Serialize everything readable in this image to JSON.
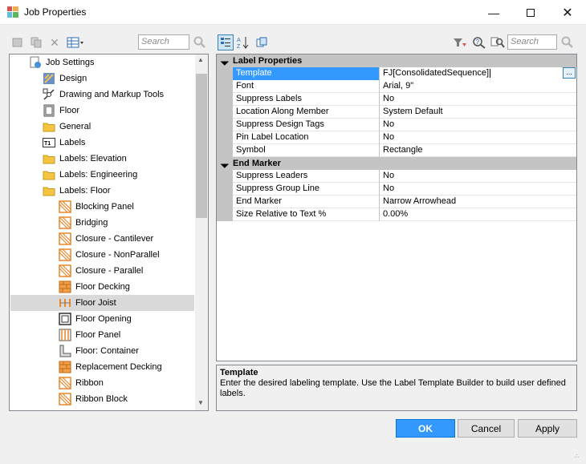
{
  "window": {
    "title": "Job Properties",
    "icon": "job-properties-icon"
  },
  "toolbar_left": {
    "icons": [
      "new-icon",
      "copy-icon",
      "delete-icon",
      "view-options-icon"
    ],
    "search_placeholder": "Search"
  },
  "toolbar_right": {
    "icons": [
      "categorized-icon",
      "sort-alpha-icon",
      "property-pages-icon"
    ],
    "filter_icons": [
      "filter-icon",
      "help-search-icon",
      "find-icon"
    ],
    "search_placeholder": "Search"
  },
  "tree": {
    "items": [
      {
        "label": "Job Settings",
        "icon": "job-settings-icon"
      },
      {
        "label": "Design",
        "icon": "design-icon"
      },
      {
        "label": "Drawing and Markup Tools",
        "icon": "markup-tools-icon"
      },
      {
        "label": "Floor",
        "icon": "floor-icon"
      },
      {
        "label": "General",
        "icon": "folder-icon"
      },
      {
        "label": "Labels",
        "icon": "labels-t1-icon"
      },
      {
        "label": "Labels: Elevation",
        "icon": "folder-icon"
      },
      {
        "label": "Labels: Engineering",
        "icon": "folder-icon"
      },
      {
        "label": "Labels: Floor",
        "icon": "folder-icon"
      },
      {
        "label": "Blocking Panel",
        "icon": "blocking-panel-icon"
      },
      {
        "label": "Bridging",
        "icon": "bridging-icon"
      },
      {
        "label": "Closure - Cantilever",
        "icon": "closure-icon"
      },
      {
        "label": "Closure - NonParallel",
        "icon": "closure-icon"
      },
      {
        "label": "Closure - Parallel",
        "icon": "closure-icon"
      },
      {
        "label": "Floor Decking",
        "icon": "decking-icon"
      },
      {
        "label": "Floor Joist",
        "icon": "joist-icon",
        "selected": true
      },
      {
        "label": "Floor Opening",
        "icon": "opening-icon"
      },
      {
        "label": "Floor Panel",
        "icon": "panel-icon"
      },
      {
        "label": "Floor: Container",
        "icon": "container-icon"
      },
      {
        "label": "Replacement Decking",
        "icon": "decking-icon"
      },
      {
        "label": "Ribbon",
        "icon": "ribbon-icon"
      },
      {
        "label": "Ribbon Block",
        "icon": "ribbon-block-icon"
      }
    ]
  },
  "grid": {
    "categories": [
      {
        "name": "Label Properties",
        "rows": [
          {
            "name": "Template",
            "value": "FJ[ConsolidatedSequence]",
            "selected": true
          },
          {
            "name": "Font",
            "value": "Arial, 9\""
          },
          {
            "name": "Suppress Labels",
            "value": "No"
          },
          {
            "name": "Location Along Member",
            "value": "System Default"
          },
          {
            "name": "Suppress Design Tags",
            "value": "No"
          },
          {
            "name": "Pin Label Location",
            "value": "No"
          },
          {
            "name": "Symbol",
            "value": "Rectangle"
          }
        ]
      },
      {
        "name": "End Marker",
        "rows": [
          {
            "name": "Suppress Leaders",
            "value": "No"
          },
          {
            "name": "Suppress Group Line",
            "value": "No"
          },
          {
            "name": "End Marker",
            "value": "Narrow Arrowhead"
          },
          {
            "name": "Size Relative to Text %",
            "value": "0.00%"
          }
        ]
      }
    ],
    "ellipsis_label": "..."
  },
  "help": {
    "title": "Template",
    "text": "Enter the desired labeling template.  Use the Label Template Builder to build user defined labels."
  },
  "buttons": {
    "ok": "OK",
    "cancel": "Cancel",
    "apply": "Apply"
  },
  "colors": {
    "accent": "#3399ff",
    "category_bg": "#c4c4c4",
    "folder": "#f5c542",
    "member_orange": "#e8862a"
  }
}
